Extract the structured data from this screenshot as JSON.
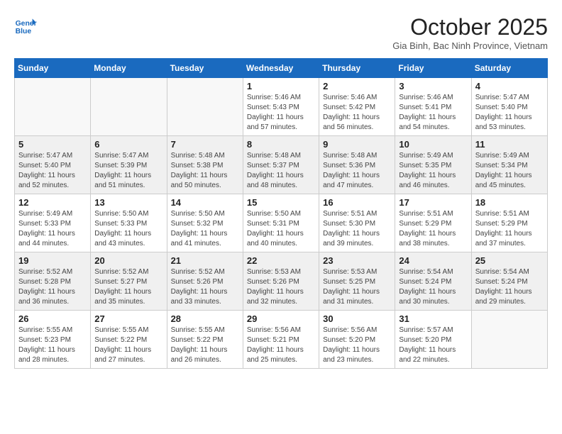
{
  "header": {
    "logo_line1": "General",
    "logo_line2": "Blue",
    "month": "October 2025",
    "location": "Gia Binh, Bac Ninh Province, Vietnam"
  },
  "weekdays": [
    "Sunday",
    "Monday",
    "Tuesday",
    "Wednesday",
    "Thursday",
    "Friday",
    "Saturday"
  ],
  "weeks": [
    [
      {
        "day": "",
        "info": ""
      },
      {
        "day": "",
        "info": ""
      },
      {
        "day": "",
        "info": ""
      },
      {
        "day": "1",
        "info": "Sunrise: 5:46 AM\nSunset: 5:43 PM\nDaylight: 11 hours and 57 minutes."
      },
      {
        "day": "2",
        "info": "Sunrise: 5:46 AM\nSunset: 5:42 PM\nDaylight: 11 hours and 56 minutes."
      },
      {
        "day": "3",
        "info": "Sunrise: 5:46 AM\nSunset: 5:41 PM\nDaylight: 11 hours and 54 minutes."
      },
      {
        "day": "4",
        "info": "Sunrise: 5:47 AM\nSunset: 5:40 PM\nDaylight: 11 hours and 53 minutes."
      }
    ],
    [
      {
        "day": "5",
        "info": "Sunrise: 5:47 AM\nSunset: 5:40 PM\nDaylight: 11 hours and 52 minutes."
      },
      {
        "day": "6",
        "info": "Sunrise: 5:47 AM\nSunset: 5:39 PM\nDaylight: 11 hours and 51 minutes."
      },
      {
        "day": "7",
        "info": "Sunrise: 5:48 AM\nSunset: 5:38 PM\nDaylight: 11 hours and 50 minutes."
      },
      {
        "day": "8",
        "info": "Sunrise: 5:48 AM\nSunset: 5:37 PM\nDaylight: 11 hours and 48 minutes."
      },
      {
        "day": "9",
        "info": "Sunrise: 5:48 AM\nSunset: 5:36 PM\nDaylight: 11 hours and 47 minutes."
      },
      {
        "day": "10",
        "info": "Sunrise: 5:49 AM\nSunset: 5:35 PM\nDaylight: 11 hours and 46 minutes."
      },
      {
        "day": "11",
        "info": "Sunrise: 5:49 AM\nSunset: 5:34 PM\nDaylight: 11 hours and 45 minutes."
      }
    ],
    [
      {
        "day": "12",
        "info": "Sunrise: 5:49 AM\nSunset: 5:33 PM\nDaylight: 11 hours and 44 minutes."
      },
      {
        "day": "13",
        "info": "Sunrise: 5:50 AM\nSunset: 5:33 PM\nDaylight: 11 hours and 43 minutes."
      },
      {
        "day": "14",
        "info": "Sunrise: 5:50 AM\nSunset: 5:32 PM\nDaylight: 11 hours and 41 minutes."
      },
      {
        "day": "15",
        "info": "Sunrise: 5:50 AM\nSunset: 5:31 PM\nDaylight: 11 hours and 40 minutes."
      },
      {
        "day": "16",
        "info": "Sunrise: 5:51 AM\nSunset: 5:30 PM\nDaylight: 11 hours and 39 minutes."
      },
      {
        "day": "17",
        "info": "Sunrise: 5:51 AM\nSunset: 5:29 PM\nDaylight: 11 hours and 38 minutes."
      },
      {
        "day": "18",
        "info": "Sunrise: 5:51 AM\nSunset: 5:29 PM\nDaylight: 11 hours and 37 minutes."
      }
    ],
    [
      {
        "day": "19",
        "info": "Sunrise: 5:52 AM\nSunset: 5:28 PM\nDaylight: 11 hours and 36 minutes."
      },
      {
        "day": "20",
        "info": "Sunrise: 5:52 AM\nSunset: 5:27 PM\nDaylight: 11 hours and 35 minutes."
      },
      {
        "day": "21",
        "info": "Sunrise: 5:52 AM\nSunset: 5:26 PM\nDaylight: 11 hours and 33 minutes."
      },
      {
        "day": "22",
        "info": "Sunrise: 5:53 AM\nSunset: 5:26 PM\nDaylight: 11 hours and 32 minutes."
      },
      {
        "day": "23",
        "info": "Sunrise: 5:53 AM\nSunset: 5:25 PM\nDaylight: 11 hours and 31 minutes."
      },
      {
        "day": "24",
        "info": "Sunrise: 5:54 AM\nSunset: 5:24 PM\nDaylight: 11 hours and 30 minutes."
      },
      {
        "day": "25",
        "info": "Sunrise: 5:54 AM\nSunset: 5:24 PM\nDaylight: 11 hours and 29 minutes."
      }
    ],
    [
      {
        "day": "26",
        "info": "Sunrise: 5:55 AM\nSunset: 5:23 PM\nDaylight: 11 hours and 28 minutes."
      },
      {
        "day": "27",
        "info": "Sunrise: 5:55 AM\nSunset: 5:22 PM\nDaylight: 11 hours and 27 minutes."
      },
      {
        "day": "28",
        "info": "Sunrise: 5:55 AM\nSunset: 5:22 PM\nDaylight: 11 hours and 26 minutes."
      },
      {
        "day": "29",
        "info": "Sunrise: 5:56 AM\nSunset: 5:21 PM\nDaylight: 11 hours and 25 minutes."
      },
      {
        "day": "30",
        "info": "Sunrise: 5:56 AM\nSunset: 5:20 PM\nDaylight: 11 hours and 23 minutes."
      },
      {
        "day": "31",
        "info": "Sunrise: 5:57 AM\nSunset: 5:20 PM\nDaylight: 11 hours and 22 minutes."
      },
      {
        "day": "",
        "info": ""
      }
    ]
  ]
}
